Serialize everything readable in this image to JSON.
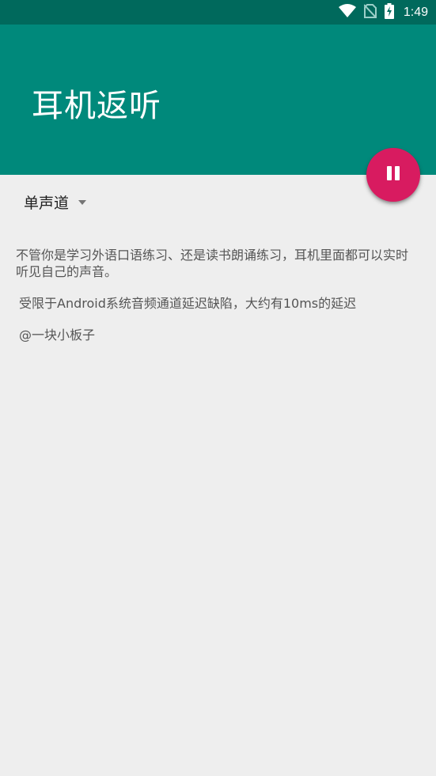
{
  "status_bar": {
    "time": "1:49",
    "icons": [
      "wifi-icon",
      "no-sim-icon",
      "battery-charging-icon"
    ]
  },
  "app_bar": {
    "title": "耳机返听"
  },
  "fab": {
    "icon": "pause-icon",
    "color": "#d81b60"
  },
  "channel_spinner": {
    "selected": "单声道"
  },
  "content": {
    "description": "不管你是学习外语口语练习、还是读书朗诵练习，耳机里面都可以实时听见自己的声音。",
    "latency_note": "受限于Android系统音频通道延迟缺陷，大约有10ms的延迟",
    "author": "@一块小板子"
  },
  "colors": {
    "status_bar": "#00695c",
    "primary": "#00897b",
    "accent": "#d81b60",
    "background": "#eeeeee"
  }
}
